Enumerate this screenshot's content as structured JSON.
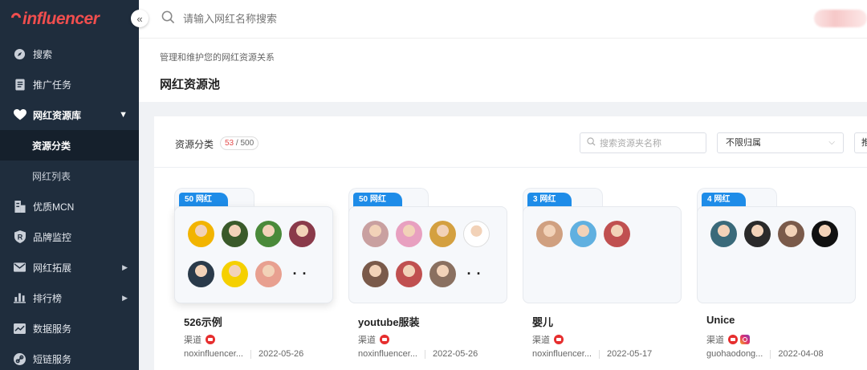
{
  "brand": {
    "logo_text": "nfluencer",
    "accent": "#f04e4e"
  },
  "sidebar": {
    "collapse_icon": "«",
    "items": [
      {
        "label": "搜索",
        "icon": "compass-icon"
      },
      {
        "label": "推广任务",
        "icon": "document-icon"
      },
      {
        "label": "网红资源库",
        "icon": "heart-icon",
        "expanded": true
      },
      {
        "label": "优质MCN",
        "icon": "building-icon"
      },
      {
        "label": "品牌监控",
        "icon": "shield-r-icon"
      },
      {
        "label": "网红拓展",
        "icon": "mail-icon"
      },
      {
        "label": "排行榜",
        "icon": "bar-chart-icon"
      },
      {
        "label": "数据服务",
        "icon": "trend-icon"
      },
      {
        "label": "短链服务",
        "icon": "link-icon"
      }
    ],
    "subitems": [
      {
        "label": "资源分类",
        "active": true
      },
      {
        "label": "网红列表",
        "active": false
      }
    ]
  },
  "topbar": {
    "search_placeholder": "请输入网红名称搜索"
  },
  "page": {
    "breadcrumb": "管理和维护您的网红资源关系",
    "title": "网红资源池"
  },
  "panel": {
    "category_label": "资源分类",
    "count_used": "53",
    "count_total": "/ 500",
    "folder_search_placeholder": "搜索资源夹名称",
    "owner_select": "不限归属",
    "extra_select": "推"
  },
  "cards": [
    {
      "tag": "50 网红",
      "name": "526示例",
      "channel_label": "渠道",
      "owner": "noxinfluencer...",
      "date": "2022-05-26",
      "avatars": [
        "#f2b400",
        "#3a5a2a",
        "#4a8a3a",
        "#8a3a4a",
        "#2a3a4a",
        "#f5d000",
        "#e8a090"
      ],
      "more": true
    },
    {
      "tag": "50 网红",
      "name": "youtube服装",
      "channel_label": "渠道",
      "owner": "noxinfluencer...",
      "date": "2022-05-26",
      "avatars": [
        "#c9a0a0",
        "#e8a0c0",
        "#d4a040",
        "#ffffff",
        "#7a5a4a",
        "#c05050",
        "#8a7060"
      ],
      "more": true
    },
    {
      "tag": "3 网红",
      "name": "婴儿",
      "channel_label": "渠道",
      "owner": "noxinfluencer...",
      "date": "2022-05-17",
      "avatars": [
        "#d0a080",
        "#60b0e0",
        "#c05050"
      ],
      "more": false
    },
    {
      "tag": "4 网红",
      "name": "Unice",
      "channel_label": "渠道",
      "owner": "guohaodong...",
      "date": "2022-04-08",
      "avatars": [
        "#3a6a7a",
        "#2a2a2a",
        "#7a5a4a",
        "#111111"
      ],
      "more": false
    }
  ]
}
